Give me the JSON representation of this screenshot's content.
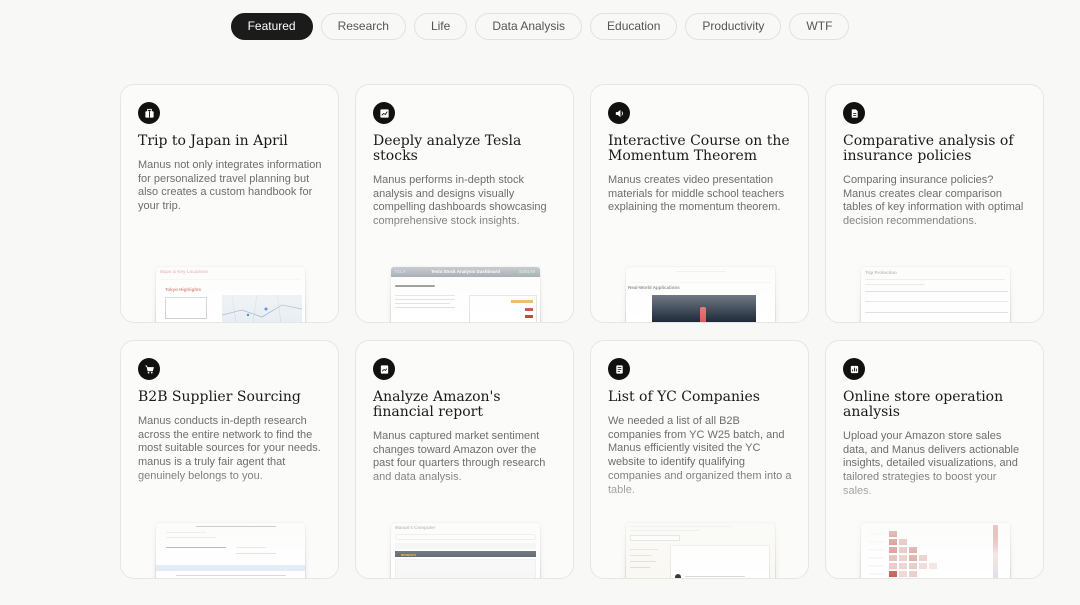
{
  "tabs": [
    {
      "label": "Featured",
      "active": true
    },
    {
      "label": "Research",
      "active": false
    },
    {
      "label": "Life",
      "active": false
    },
    {
      "label": "Data Analysis",
      "active": false
    },
    {
      "label": "Education",
      "active": false
    },
    {
      "label": "Productivity",
      "active": false
    },
    {
      "label": "WTF",
      "active": false
    }
  ],
  "cards": [
    {
      "icon": "suitcase-icon",
      "title": "Trip to Japan in April",
      "desc": "Manus not only integrates information for personalized travel planning but also creates a custom handbook for your trip.",
      "preview": {
        "heading": "Maps & Key Locations",
        "subheading": "Tokyo Highlights"
      }
    },
    {
      "icon": "chart-icon",
      "title": "Deeply analyze Tesla stocks",
      "desc": "Manus performs in-depth stock analysis and designs visually compelling dashboards showcasing comprehensive stock insights.",
      "preview": {
        "heading": "Tesla Stock Analysis Dashboard",
        "price": "$284.65",
        "logo": "TSLA"
      }
    },
    {
      "icon": "speaker-icon",
      "title": "Interactive Course on the Momentum Theorem",
      "desc": "Manus creates video presentation materials for middle school teachers explaining the momentum theorem.",
      "preview": {
        "heading": "Real-World Applications"
      }
    },
    {
      "icon": "document-icon",
      "title": "Comparative analysis of insurance policies",
      "desc": "Comparing insurance policies? Manus creates clear comparison tables of key information with optimal decision recommendations.",
      "preview": {
        "heading": "Trip Protection"
      }
    },
    {
      "icon": "cart-icon",
      "title": "B2B Supplier Sourcing",
      "desc": "Manus conducts in-depth research across the entire network to find the most suitable sources for your needs. manus is a truly fair agent that genuinely belongs to you.",
      "preview": {}
    },
    {
      "icon": "file-chart-icon",
      "title": "Analyze Amazon's financial report",
      "desc": "Manus captured market sentiment changes toward Amazon over the past four quarters through research and data analysis.",
      "preview": {
        "heading": "Manus's Computer",
        "logo": "amazon"
      }
    },
    {
      "icon": "list-icon",
      "title": "List of YC Companies",
      "desc": "We needed a list of all B2B companies from YC W25 batch, and Manus efficiently visited the YC website to identify qualifying companies and organized them into a table.",
      "preview": {}
    },
    {
      "icon": "store-chart-icon",
      "title": "Online store operation analysis",
      "desc": "Upload your Amazon store sales data, and Manus delivers actionable insights, detailed visualizations, and tailored strategies to boost your sales.",
      "preview": {}
    }
  ],
  "colors": {
    "tab_active_bg": "#1b1b1b",
    "accent_red": "#c0392b",
    "page_bg": "#f8f8f7"
  }
}
